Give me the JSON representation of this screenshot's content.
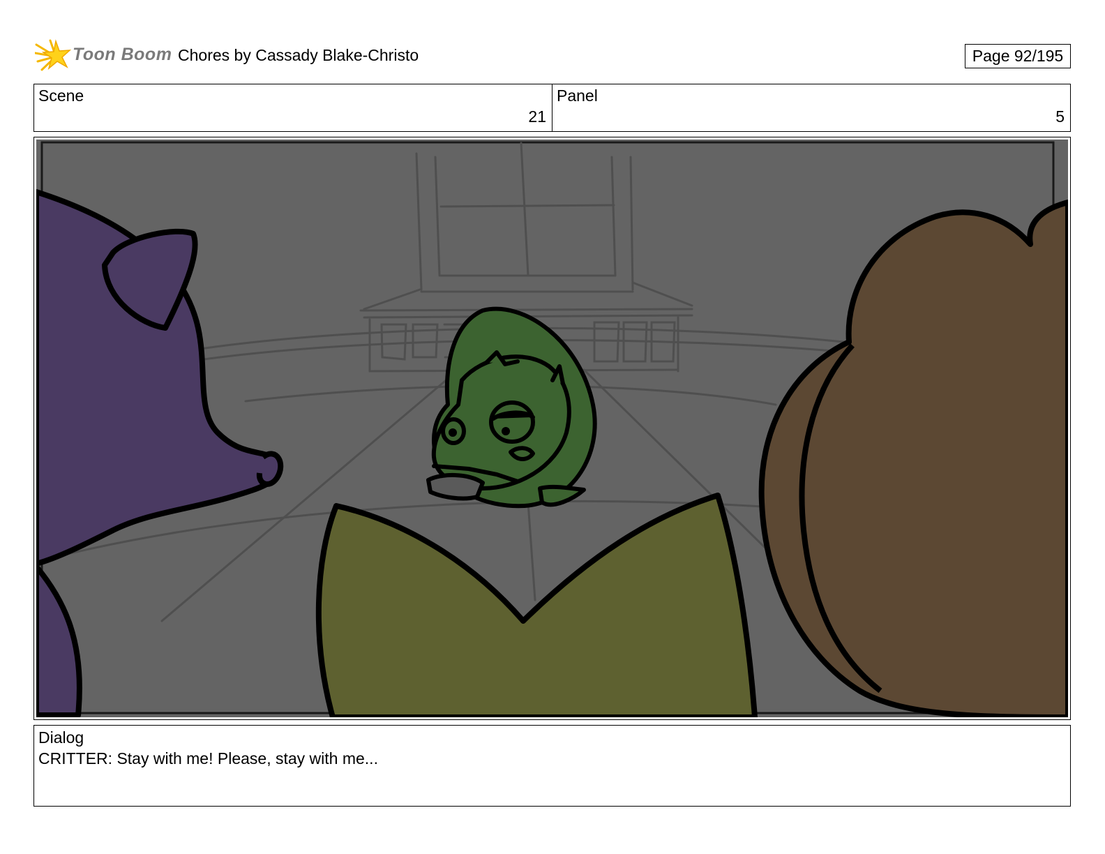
{
  "header": {
    "logo_text": "Toon Boom",
    "title": "Chores  by Cassady Blake-Christo",
    "page": "Page  92/195"
  },
  "scene": {
    "label": "Scene",
    "value": "21"
  },
  "panel": {
    "label": "Panel",
    "value": "5"
  },
  "dialog": {
    "label": "Dialog",
    "text": "CRITTER: Stay with me! Please, stay with me..."
  },
  "colors": {
    "background_gray": "#646464",
    "purple_character": "#4a3a62",
    "olive_character": "#5e6130",
    "brown_character": "#5c4833",
    "green_character": "#3c6330",
    "logo_star": "#f5c000"
  },
  "icons": [
    "toon-boom-star-logo"
  ]
}
